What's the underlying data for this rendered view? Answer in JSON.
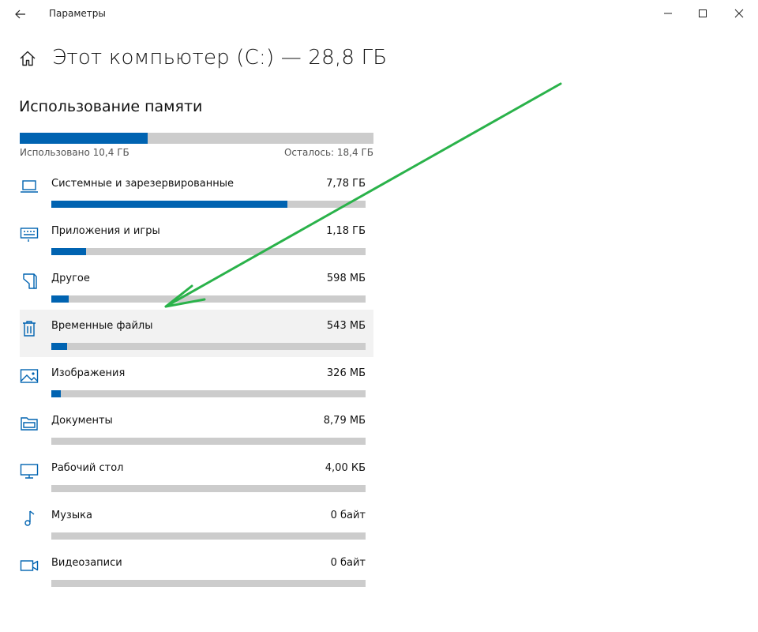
{
  "window": {
    "title": "Параметры"
  },
  "header": {
    "title": "Этот компьютер (C:) — 28,8 ГБ"
  },
  "section": {
    "title": "Использование памяти"
  },
  "total": {
    "used_label": "Использовано 10,4 ГБ",
    "free_label": "Осталось: 18,4 ГБ",
    "used_fraction": 0.361
  },
  "categories": [
    {
      "label": "Системные и зарезервированные",
      "size": "7,78 ГБ",
      "fraction": 0.75,
      "icon": "laptop-icon"
    },
    {
      "label": "Приложения и игры",
      "size": "1,18 ГБ",
      "fraction": 0.11,
      "icon": "keyboard-icon"
    },
    {
      "label": "Другое",
      "size": "598 МБ",
      "fraction": 0.055,
      "icon": "other-files-icon"
    },
    {
      "label": "Временные файлы",
      "size": "543 МБ",
      "fraction": 0.05,
      "icon": "trash-icon"
    },
    {
      "label": "Изображения",
      "size": "326 МБ",
      "fraction": 0.03,
      "icon": "image-icon"
    },
    {
      "label": "Документы",
      "size": "8,79 МБ",
      "fraction": 0.0,
      "icon": "folder-icon"
    },
    {
      "label": "Рабочий стол",
      "size": "4,00 КБ",
      "fraction": 0.0,
      "icon": "monitor-icon"
    },
    {
      "label": "Музыка",
      "size": "0 байт",
      "fraction": 0.0,
      "icon": "music-note-icon"
    },
    {
      "label": "Видеозаписи",
      "size": "0 байт",
      "fraction": 0.0,
      "icon": "video-camera-icon"
    }
  ],
  "colors": {
    "accent": "#0063b1",
    "track": "#cccccc",
    "arrow": "#2ab24a",
    "hover": "#f2f2f2"
  }
}
